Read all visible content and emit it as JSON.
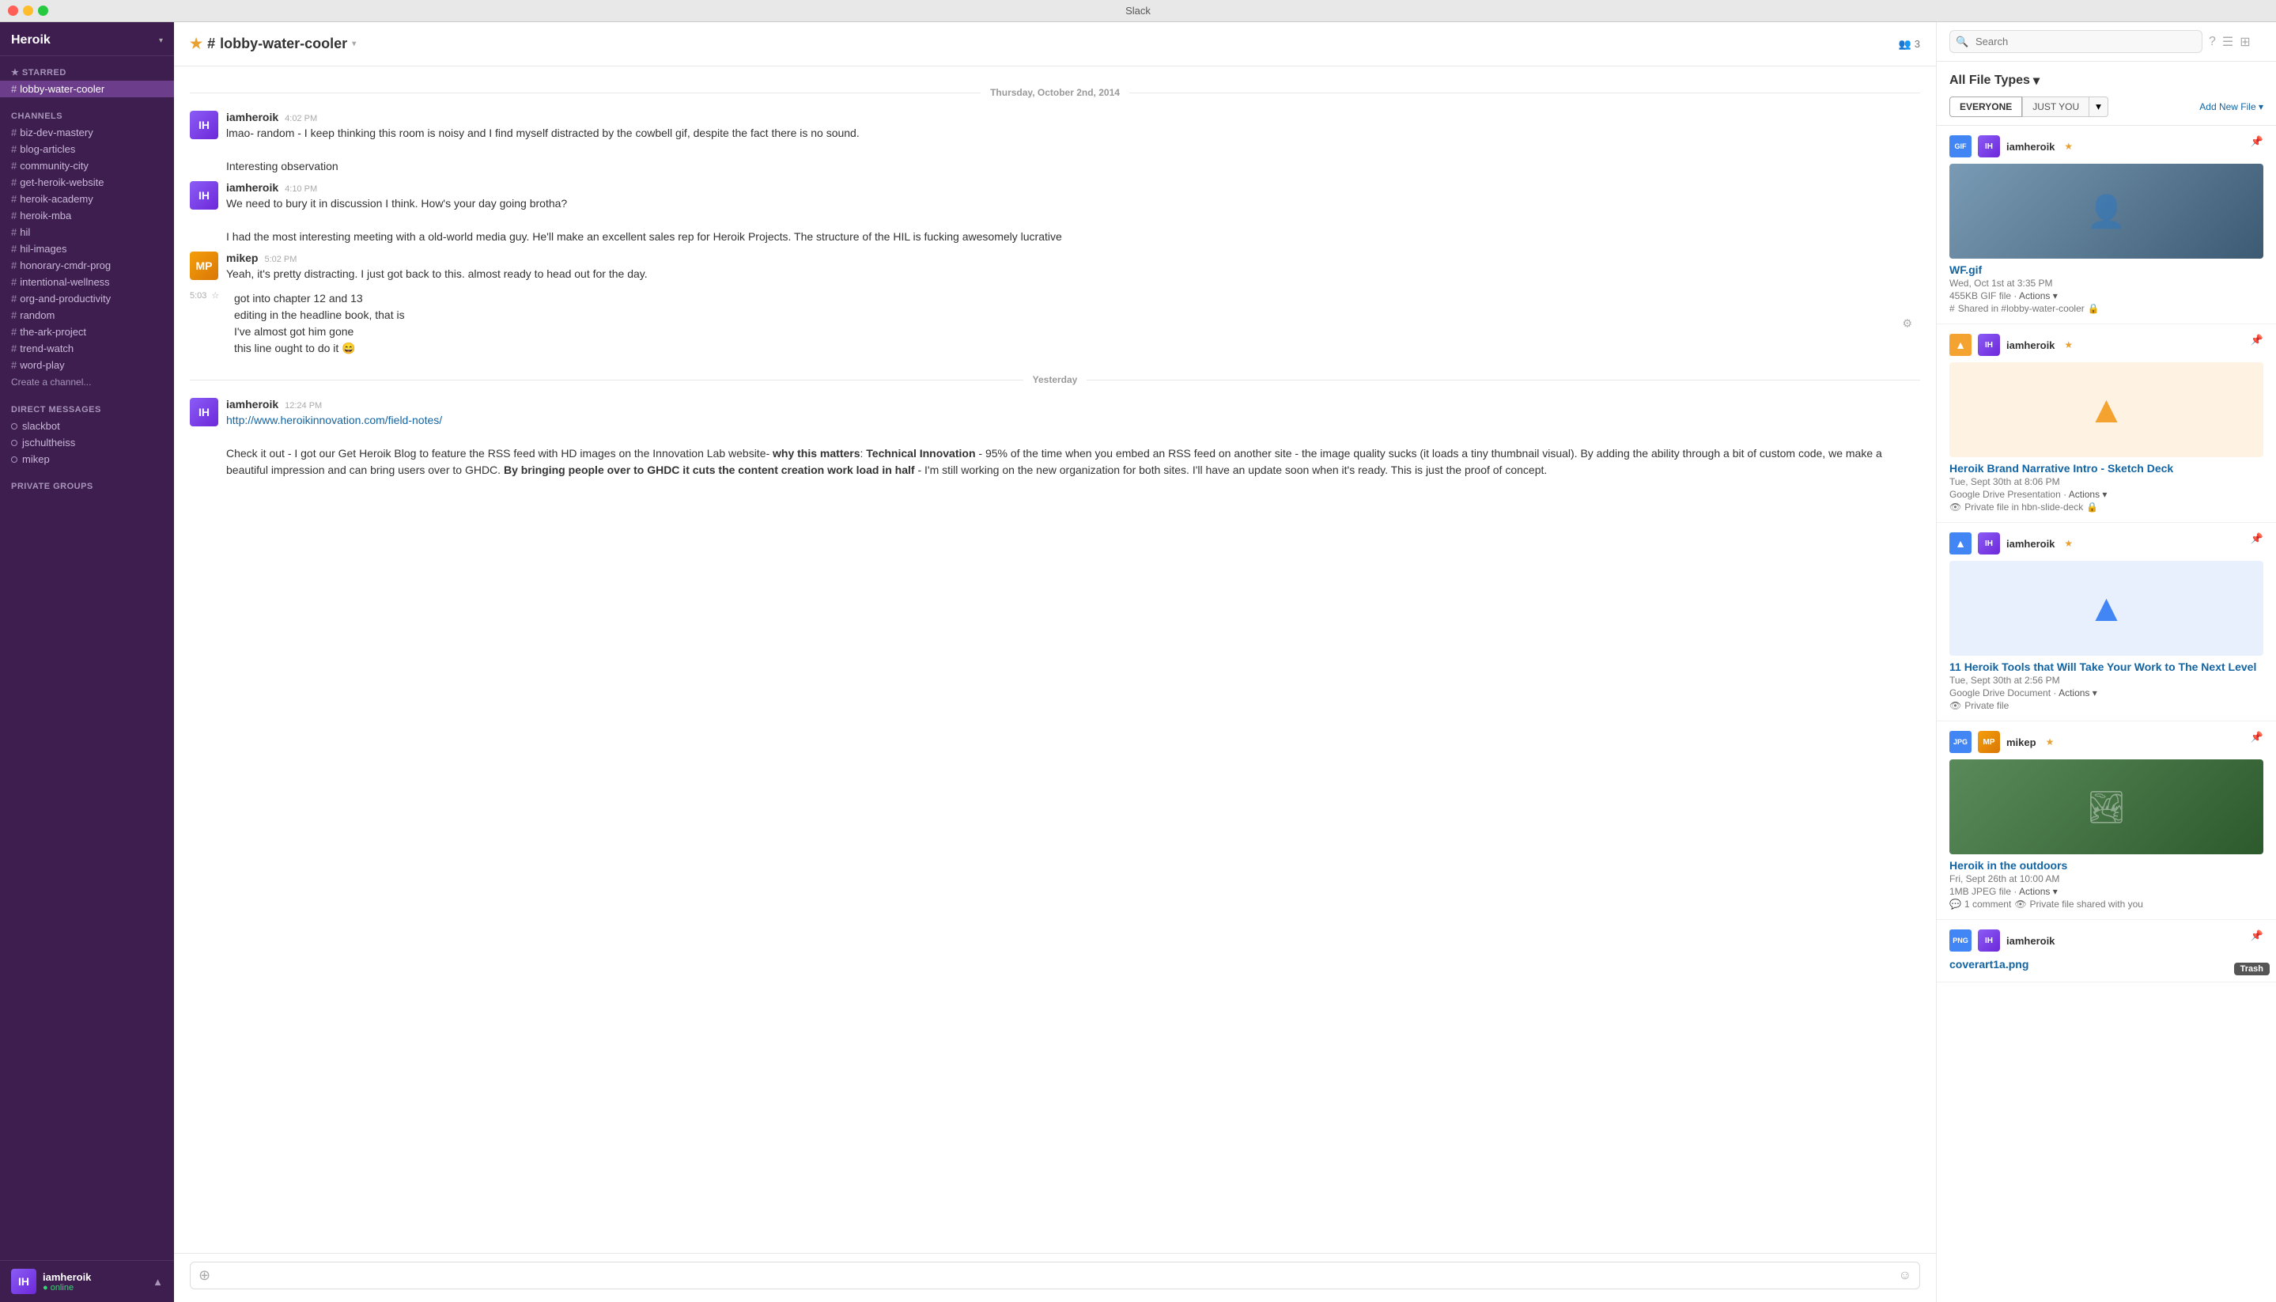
{
  "titleBar": {
    "title": "Slack"
  },
  "sidebar": {
    "workspaceName": "Heroik",
    "chevron": "▾",
    "sections": {
      "starred": {
        "label": "STARRED",
        "items": [
          {
            "id": "lobby-water-cooler",
            "name": "lobby-water-cooler",
            "prefix": "#",
            "active": true
          }
        ]
      },
      "channels": {
        "label": "CHANNELS",
        "items": [
          {
            "id": "biz-dev-mastery",
            "name": "biz-dev-mastery",
            "prefix": "#"
          },
          {
            "id": "blog-articles",
            "name": "blog-articles",
            "prefix": "#"
          },
          {
            "id": "community-city",
            "name": "community-city",
            "prefix": "#"
          },
          {
            "id": "get-heroik-website",
            "name": "get-heroik-website",
            "prefix": "#"
          },
          {
            "id": "heroik-academy",
            "name": "heroik-academy",
            "prefix": "#"
          },
          {
            "id": "heroik-mba",
            "name": "heroik-mba",
            "prefix": "#"
          },
          {
            "id": "hil",
            "name": "hil",
            "prefix": "#"
          },
          {
            "id": "hil-images",
            "name": "hil-images",
            "prefix": "#"
          },
          {
            "id": "honorary-cmdr-prog",
            "name": "honorary-cmdr-prog",
            "prefix": "#"
          },
          {
            "id": "intentional-wellness",
            "name": "intentional-wellness",
            "prefix": "#"
          },
          {
            "id": "org-and-productivity",
            "name": "org-and-productivity",
            "prefix": "#"
          },
          {
            "id": "random",
            "name": "random",
            "prefix": "#"
          },
          {
            "id": "the-ark-project",
            "name": "the-ark-project",
            "prefix": "#"
          },
          {
            "id": "trend-watch",
            "name": "trend-watch",
            "prefix": "#"
          },
          {
            "id": "word-play",
            "name": "word-play",
            "prefix": "#"
          }
        ],
        "createChannel": "Create a channel..."
      },
      "directMessages": {
        "label": "DIRECT MESSAGES",
        "items": [
          {
            "id": "slackbot",
            "name": "slackbot",
            "status": "offline"
          },
          {
            "id": "jschultheiss",
            "name": "jschultheiss",
            "status": "offline"
          },
          {
            "id": "mikep",
            "name": "mikep",
            "status": "offline"
          }
        ]
      },
      "privateGroups": {
        "label": "PRIVATE GROUPS"
      }
    },
    "currentUser": {
      "name": "iamheroik",
      "status": "online",
      "statusLabel": "● online"
    }
  },
  "chat": {
    "channelName": "#lobby-water-cooler",
    "channelStar": "★",
    "chevron": "▾",
    "memberCount": "3",
    "memberIcon": "👥",
    "dateDividers": {
      "thursday": "Thursday, October 2nd, 2014",
      "yesterday": "Yesterday"
    },
    "messages": [
      {
        "id": "msg1",
        "author": "iamheroik",
        "time": "4:02 PM",
        "lines": [
          "lmao- random - I keep thinking this room is noisy and I find myself distracted by the cowbell gif,",
          "despite the fact there is no sound.",
          "",
          "Interesting observation"
        ]
      },
      {
        "id": "msg2",
        "author": "iamheroik",
        "time": "4:10 PM",
        "lines": [
          "We need to bury it in discussion I think. How's your day going brotha?",
          "",
          "I had the most interesting meeting with a old-world media guy. He'll make an excellent sales rep for",
          "Heroik Projects. The structure of the HIL is fucking awesomely lucrative"
        ]
      },
      {
        "id": "msg3",
        "author": "mikep",
        "time": "5:02 PM",
        "lines": [
          "Yeah, it's pretty distracting.  I just got back to this.  almost ready to head out for the day."
        ]
      },
      {
        "id": "msg4",
        "inlineTime": "5:03",
        "lines": [
          "got into chapter 12 and 13",
          "editing in the headline book, that is",
          "I've almost got him gone",
          "this line ought to do it 😄"
        ]
      }
    ],
    "yesterdayMessages": [
      {
        "id": "msg5",
        "author": "iamheroik",
        "time": "12:24 PM",
        "link": "http://www.heroikinnovation.com/field-notes/",
        "text": "Check it out - I got our Get Heroik Blog to feature the RSS feed with HD images on the Innovation Lab website- why this matters:  Technical Innovation - 95% of the time when you embed an RSS feed on another site - the image quality sucks (it loads a tiny thumbnail visual).  By adding the ability through a bit of custom code, we make a beautiful impression and can bring users over to GHDC. By bringing people over to GHDC it cuts the content creation work load in half - I'm still working on the new organization for both sites. I'll have an update soon when it's ready. This is just the proof of concept."
      }
    ],
    "inputPlaceholder": ""
  },
  "rightPanel": {
    "title": "All File Types",
    "titleChevron": "▾",
    "filters": {
      "everyone": "EVERYONE",
      "justYou": "JUST YOU",
      "dropdownArrow": "▾"
    },
    "addFileBtn": "Add New File ▾",
    "searchPlaceholder": "Search",
    "files": [
      {
        "id": "file1",
        "uploader": "iamheroik",
        "name": "WF.gif",
        "starred": true,
        "type": "gif",
        "typeLabel": "GIF",
        "date": "Wed, Oct 1st at 3:35 PM",
        "meta": "455KB GIF file · Actions ▾",
        "shared": "Shared in #lobby-water-cooler",
        "hasPinIcon": true
      },
      {
        "id": "file2",
        "uploader": "iamheroik",
        "name": "Heroik Brand Narrative Intro - Sketch Deck",
        "starred": true,
        "type": "slides",
        "typeLabel": "▲",
        "date": "Tue, Sept 30th at 8:06 PM",
        "meta": "Google Drive Presentation · Actions ▾",
        "metaActions": "Google Drive Presentation Actions",
        "shared": "Private file in hbn-slide-deck",
        "hasLock": true,
        "hasPinIcon": true
      },
      {
        "id": "file3",
        "uploader": "iamheroik",
        "name": "11 Heroik Tools that Will Take Your Work to The Next Level",
        "starred": true,
        "type": "doc",
        "typeLabel": "▲",
        "date": "Tue, Sept 30th at 2:56 PM",
        "meta": "Google Drive Document · Actions ▾",
        "metaActions": "Google Drive Document Actions",
        "shared": "Private file",
        "hasLock": false,
        "hasPinIcon": true
      },
      {
        "id": "file4",
        "uploader": "mikep",
        "name": "Heroik in the outdoors",
        "starred": true,
        "type": "jpeg",
        "typeLabel": "JPG",
        "date": "Fri, Sept 26th at 10:00 AM",
        "meta": "1MB JPEG file · Actions ▾",
        "shared": "1 comment · Private file shared with you",
        "hasPinIcon": true
      },
      {
        "id": "file5",
        "uploader": "iamheroik",
        "name": "coverart1a.png",
        "type": "jpeg",
        "typeLabel": "PNG",
        "hasPinIcon": true,
        "hasTrash": true,
        "trashLabel": "Trash"
      }
    ]
  }
}
